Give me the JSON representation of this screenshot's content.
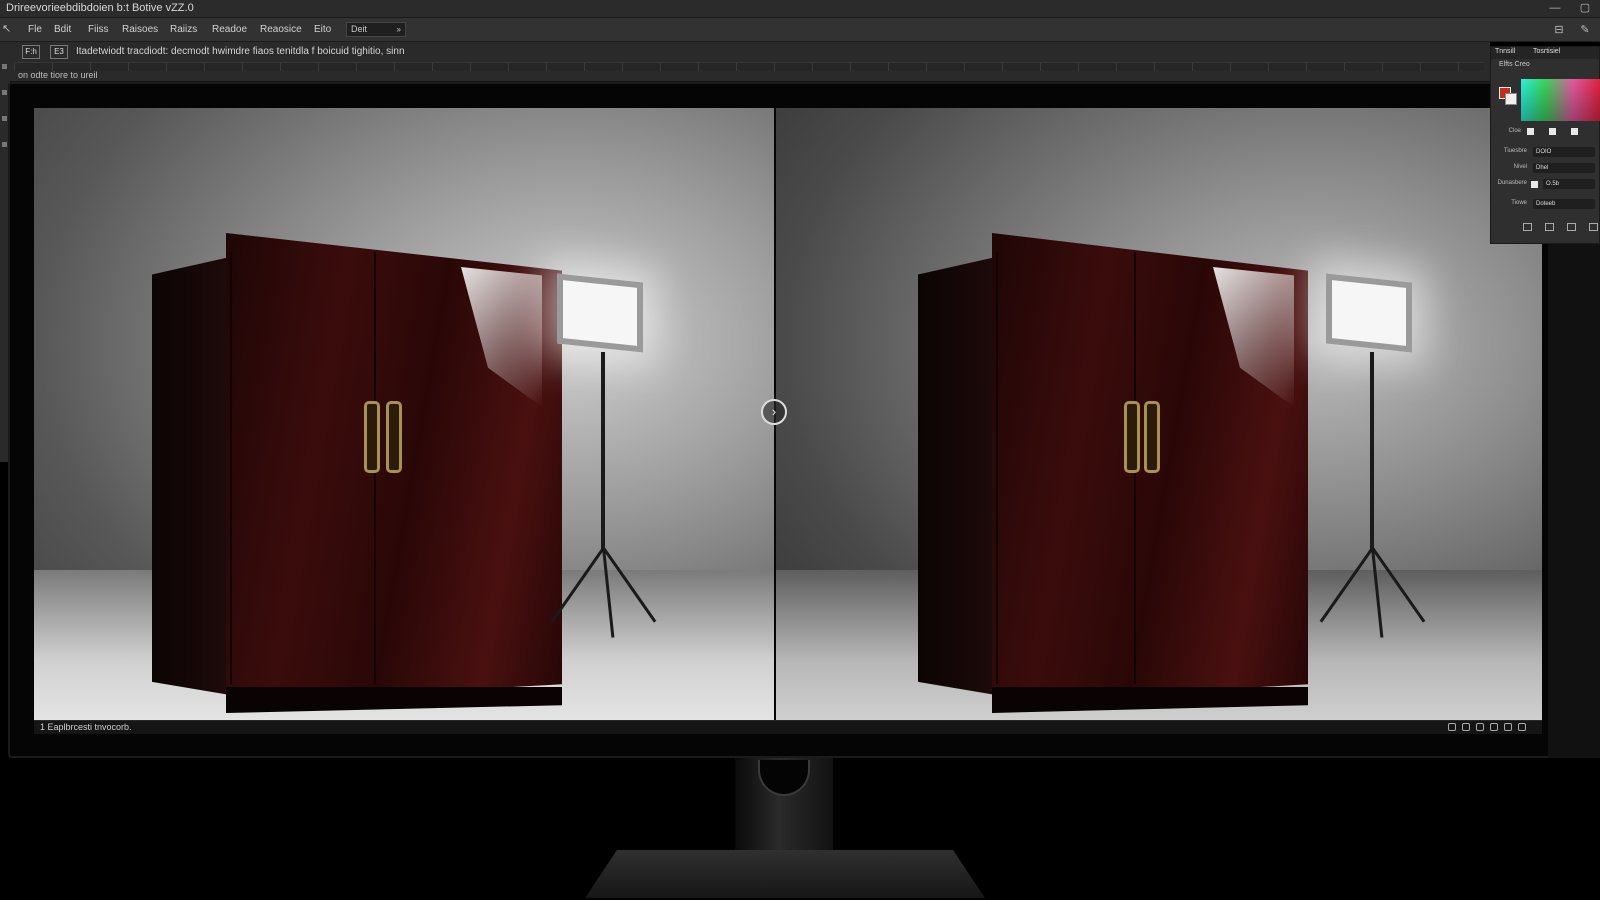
{
  "window": {
    "title": "Drireevorieebdibdoien b:t Botive vZZ.0",
    "minimize_glyph": "—",
    "maximize_glyph": "▢"
  },
  "menu": {
    "corner_glyph": "↖",
    "items": [
      "Fle",
      "Bdit",
      "Fiiss",
      "Raisoes",
      "Raiizs",
      "Readoe",
      "Reaosice",
      "Eito"
    ],
    "document_select": "Deit",
    "document_caret": "»"
  },
  "options": {
    "icon_1": "F:h",
    "icon_2": "E3",
    "text": "Itadetwiodt tracdiodt: decmodt hwimdre fiaos tenitdla f boicuid tighitio, sinn",
    "subtext": "on odte tiore  to ureil",
    "right_icon_1": "⊟",
    "right_icon_2": "✎"
  },
  "status": {
    "text": "1  Eaplbrcesti tnvocorb."
  },
  "compare_handle": "›",
  "color_panel": {
    "tabs": [
      "Tnnsill",
      "Tosrtisiel"
    ],
    "subtabs": "Elfts    Creo",
    "rows": [
      {
        "label": "Cloe",
        "value": ""
      },
      {
        "label": "Tiuesbre",
        "value": "DOIO"
      },
      {
        "label": "Nivel",
        "value": "Dhel"
      },
      {
        "label": "Dunasbere",
        "value": "O.5b"
      },
      {
        "label": "Tiowe",
        "value": "Doteeb"
      }
    ],
    "colors": {
      "foreground": "#c62a1a",
      "background": "#f0f0f0"
    }
  }
}
